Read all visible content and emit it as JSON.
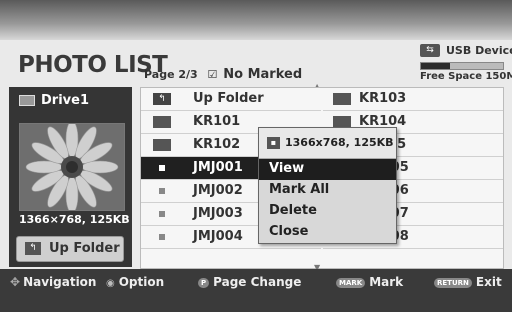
{
  "header": {
    "title": "PHOTO LIST",
    "page": "Page 2/3",
    "check_icon": "check-icon",
    "marked": "No Marked"
  },
  "usb": {
    "label": "USB Device",
    "icon": "usb-icon",
    "free_space": "Free Space 150MB",
    "used_fraction": 0.35
  },
  "left_panel": {
    "drive": "Drive1",
    "resolution": "1366×768, 125KB",
    "up_folder_label": "Up Folder"
  },
  "list": {
    "col1": [
      {
        "label": "Up Folder",
        "type": "up"
      },
      {
        "label": "KR101",
        "type": "folder"
      },
      {
        "label": "KR102",
        "type": "folder"
      },
      {
        "label": "JMJ001",
        "type": "file",
        "selected": true
      },
      {
        "label": "JMJ002",
        "type": "file"
      },
      {
        "label": "JMJ003",
        "type": "file"
      },
      {
        "label": "JMJ004",
        "type": "file"
      }
    ],
    "col2": [
      {
        "label": "KR103",
        "type": "folder"
      },
      {
        "label": "KR104",
        "type": "folder"
      },
      {
        "label": "KR105",
        "type": "folder"
      },
      {
        "label": "JMJ005",
        "type": "file"
      },
      {
        "label": "JMJ006",
        "type": "file"
      },
      {
        "label": "JMJ007",
        "type": "file"
      },
      {
        "label": "JMJ008",
        "type": "file"
      }
    ]
  },
  "popup": {
    "info": "1366x768, 125KB",
    "items": [
      "View",
      "Mark All",
      "Delete",
      "Close"
    ],
    "selected": 0
  },
  "footer": {
    "navigation": "Navigation",
    "option": "Option",
    "page_change": "Page Change",
    "mark_key": "MARK",
    "mark": "Mark",
    "return_key": "RETURN",
    "exit": "Exit"
  }
}
